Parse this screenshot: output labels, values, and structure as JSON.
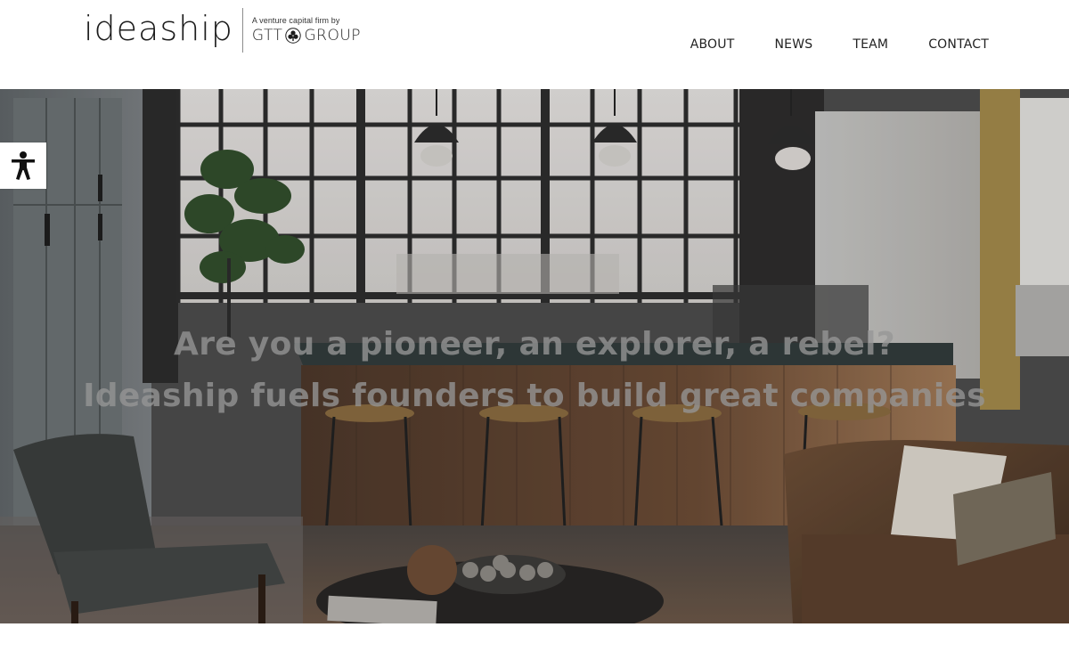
{
  "brand": {
    "wordmark": "ideaship",
    "tagline": "A venture capital firm by",
    "group_left": "GTT",
    "group_right": "GROUP",
    "emblem_icon": "gtt-emblem-icon"
  },
  "nav": {
    "items": [
      {
        "label": "ABOUT"
      },
      {
        "label": "NEWS"
      },
      {
        "label": "TEAM"
      },
      {
        "label": "CONTACT"
      }
    ]
  },
  "hero": {
    "line1": "Are you a pioneer, an explorer, a rebel?",
    "line2": "Ideaship fuels founders to build great companies",
    "text_color": "#969696"
  },
  "accessibility": {
    "icon": "accessibility-icon"
  },
  "colors": {
    "header_bg": "#ffffff",
    "text_dark": "#1c1c1c"
  }
}
